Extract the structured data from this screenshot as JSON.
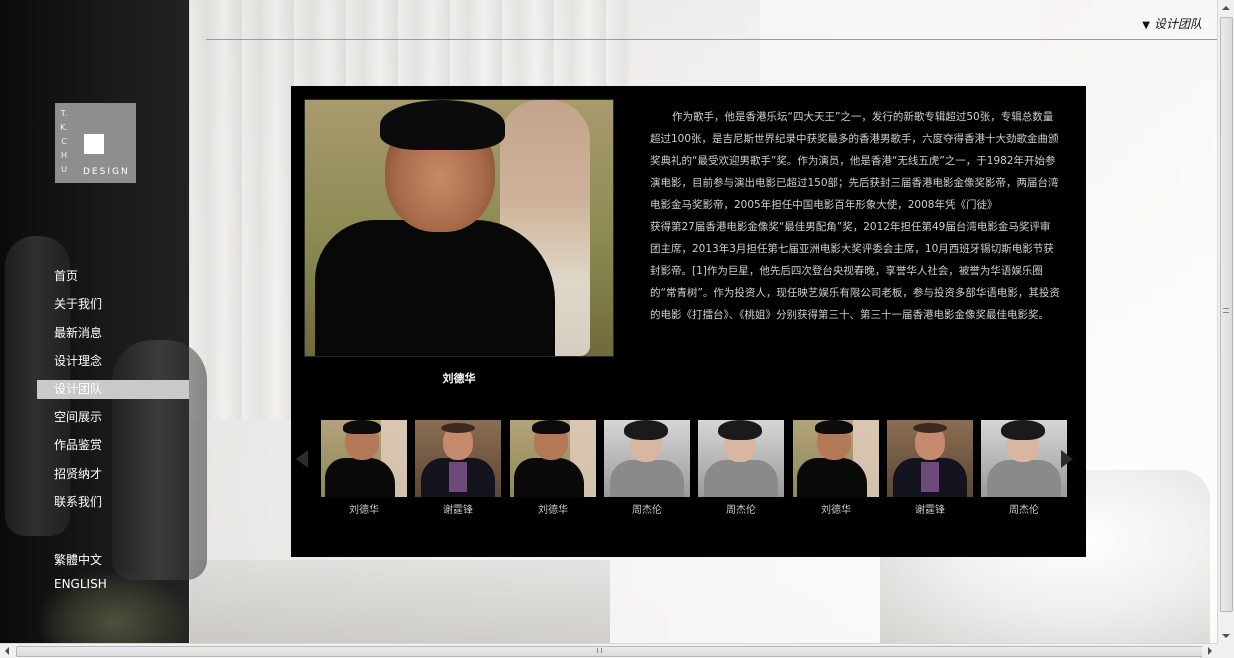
{
  "logo": {
    "vertical_text": [
      "T.",
      "K.",
      "C",
      "H",
      "U"
    ],
    "word": "DESIGN"
  },
  "nav": {
    "items": [
      {
        "label": "首页",
        "active": false
      },
      {
        "label": "关于我们",
        "active": false
      },
      {
        "label": "最新消息",
        "active": false
      },
      {
        "label": "设计理念",
        "active": false
      },
      {
        "label": "设计团队",
        "active": true
      },
      {
        "label": "空间展示",
        "active": false
      },
      {
        "label": "作品鉴赏",
        "active": false
      },
      {
        "label": "招贤纳才",
        "active": false
      },
      {
        "label": "联系我们",
        "active": false
      }
    ]
  },
  "languages": [
    "繁體中文",
    "ENGLISH"
  ],
  "breadcrumb": {
    "marker": "▼",
    "label": "设计团队"
  },
  "feature": {
    "caption": "刘德华",
    "bio_paragraphs": [
      "作为歌手，他是香港乐坛“四大天王”之一，发行的新歌专辑超过50张，专辑总数量超过100张，是吉尼斯世界纪录中获奖最多的香港男歌手，六度夺得香港十大劲歌金曲颁奖典礼的“最受欢迎男歌手”奖。作为演员，他是香港“无线五虎”之一，于1982年开始参演电影，目前参与演出电影已超过150部；先后获封三届香港电影金像奖影帝，两届台湾电影金马奖影帝，2005年担任中国电影百年形象大使，2008年凭《门徒》",
      "获得第27届香港电影金像奖“最佳男配角”奖，2012年担任第49届台湾电影金马奖评审团主席，2013年3月担任第七届亚洲电影大奖评委会主席，10月西班牙锡切斯电影节获封影帝。[1]作为巨星，他先后四次登台央视春晚，享誉华人社会，被誉为华语娱乐圈的“常青树”。作为投资人，现任映艺娱乐有限公司老板，参与投资多部华语电影，其投资的电影《打擂台》、《桃姐》分别获得第三十、第三十一届香港电影金像奖最佳电影奖。"
    ]
  },
  "thumbnails": [
    {
      "name": "刘德华",
      "style": "liu"
    },
    {
      "name": "谢霆锋",
      "style": "xie"
    },
    {
      "name": "刘德华",
      "style": "liu"
    },
    {
      "name": "周杰伦",
      "style": "zhou"
    },
    {
      "name": "周杰伦",
      "style": "zhou"
    },
    {
      "name": "刘德华",
      "style": "liu"
    },
    {
      "name": "谢霆锋",
      "style": "xie"
    },
    {
      "name": "周杰伦",
      "style": "zhou"
    }
  ],
  "icons": {
    "prev": "chevron-left-icon",
    "next": "chevron-right-icon"
  },
  "colors": {
    "panel": "#000000",
    "sidebar": "#111111",
    "active_nav": "#c9c9c9",
    "bio_text": "#cfcfcf"
  }
}
